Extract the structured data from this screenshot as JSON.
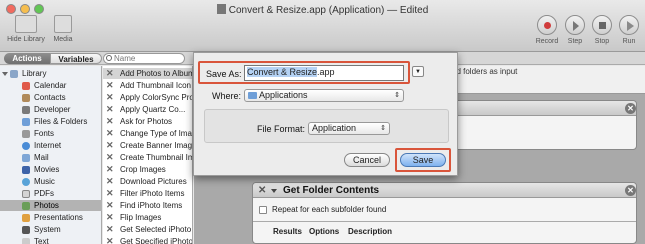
{
  "window": {
    "title": "Convert & Resize.app (Application) — Edited"
  },
  "toolbar": {
    "hide_library": "Hide Library",
    "media": "Media",
    "record": "Record",
    "step": "Step",
    "stop": "Stop",
    "run": "Run"
  },
  "librarybar": {
    "actions": "Actions",
    "variables": "Variables",
    "search_placeholder": "Name"
  },
  "library": {
    "items": [
      "Library",
      "Calendar",
      "Contacts",
      "Developer",
      "Files & Folders",
      "Fonts",
      "Internet",
      "Mail",
      "Movies",
      "Music",
      "PDFs",
      "Photos",
      "Presentations",
      "System",
      "Text"
    ]
  },
  "actions": {
    "items": [
      "Add Photos to Album",
      "Add Thumbnail Icon",
      "Apply ColorSync Profile",
      "Apply Quartz Co...",
      "Ask for Photos",
      "Change Type of Images",
      "Create Banner Image from Text",
      "Create Thumbnail Images",
      "Crop Images",
      "Download Pictures",
      "Filter iPhoto Items",
      "Find iPhoto Items",
      "Flip Images",
      "Get Selected iPhoto Items",
      "Get Specified iPhoto Items"
    ]
  },
  "workflow": {
    "top_text": "nd folders as input",
    "card1_title": "Get Folder Contents",
    "card1_checkbox": "Repeat for each subfolder found",
    "tabs": [
      "Results",
      "Options",
      "Description"
    ]
  },
  "dialog": {
    "save_as_label": "Save As:",
    "save_as_value": "Convert & Resize",
    "save_as_ext": ".app",
    "where_label": "Where:",
    "where_value": "Applications",
    "format_label": "File Format:",
    "format_value": "Application",
    "cancel": "Cancel",
    "save": "Save"
  },
  "colors": {
    "highlight": "#d9553b",
    "selection": "#b5d2f4",
    "default_button": "#7fb2ef"
  }
}
